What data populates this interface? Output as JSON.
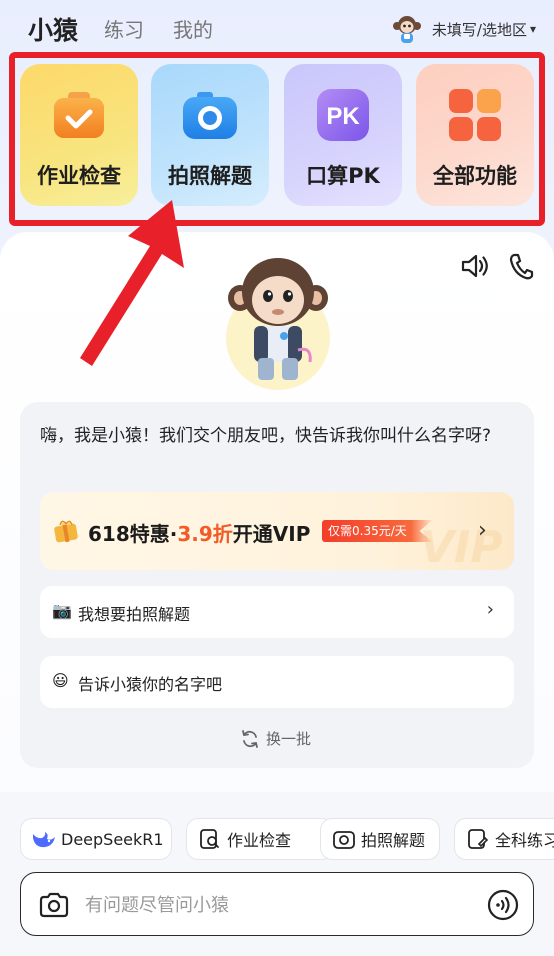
{
  "nav": {
    "tabs": [
      "小猿",
      "练习",
      "我的"
    ],
    "region": "未填写/选地区",
    "caret": "▾"
  },
  "features": [
    {
      "label": "作业检查",
      "icon": "homework-check-icon"
    },
    {
      "label": "拍照解题",
      "icon": "camera-icon"
    },
    {
      "label": "口算PK",
      "icon": "pk-icon",
      "icon_text": "PK"
    },
    {
      "label": "全部功能",
      "icon": "grid-apps-icon"
    }
  ],
  "chat": {
    "greeting": "嗨，我是小猿！我们交个朋友吧，快告诉我你叫什么名字呀?",
    "vip": {
      "prefix": "618特惠·",
      "discount": "3.9折",
      "suffix": "开通VIP",
      "badge": "仅需0.35元/天",
      "watermark": "VIP",
      "chevron": "›"
    },
    "suggestions": [
      {
        "emoji": "📷",
        "text": "我想要拍照解题",
        "chevron": "›"
      },
      {
        "emoji": "😃",
        "text": "告诉小猿你的名字吧"
      }
    ],
    "refresh": "换一批"
  },
  "chips": [
    "DeepSeekR1",
    "作业检查",
    "拍照解题",
    "全科练习"
  ],
  "input": {
    "placeholder": "有问题尽管问小猿"
  },
  "colors": {
    "highlight": "#e8202a",
    "discount": "#f25a26",
    "badge": "#f33d2b"
  }
}
